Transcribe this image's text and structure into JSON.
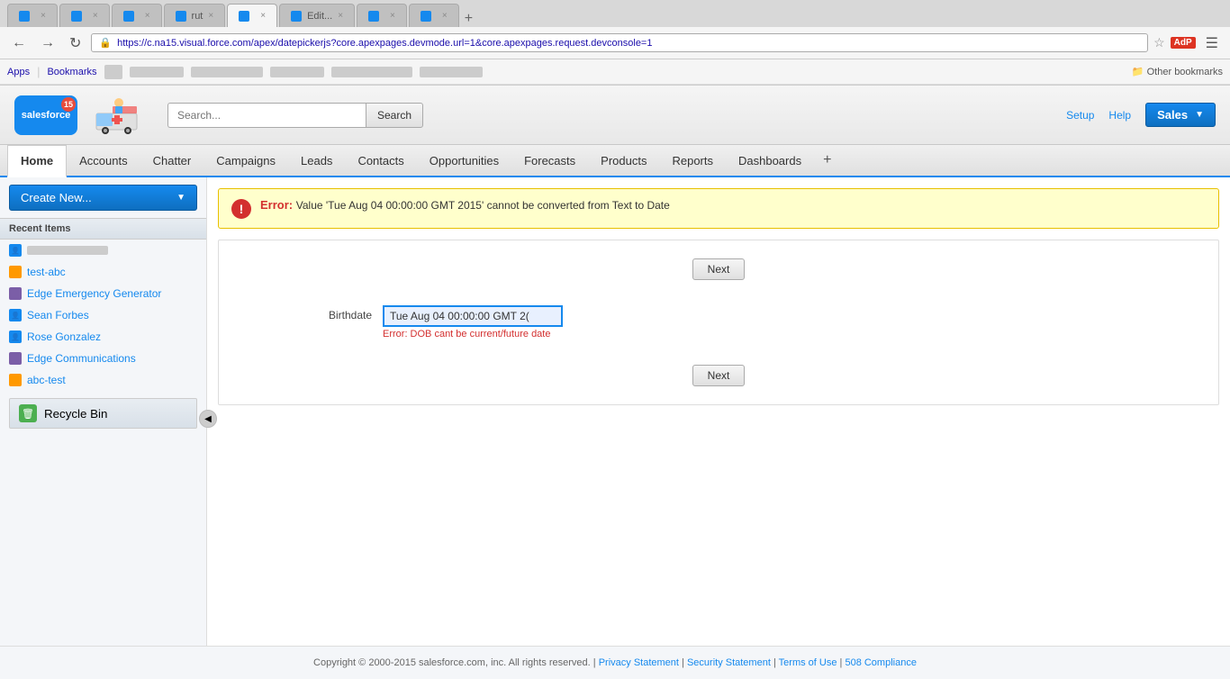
{
  "browser": {
    "url": "https://c.na15.visual.force.com/apex/datepickerjs?core.apexpages.devmode.url=1&core.apexpages.request.devconsole=1",
    "tabs": [
      {
        "label": "",
        "active": false
      },
      {
        "label": "",
        "active": false
      },
      {
        "label": "",
        "active": false
      },
      {
        "label": "rut",
        "active": false
      },
      {
        "label": "",
        "active": true
      },
      {
        "label": "Edit...",
        "active": false
      },
      {
        "label": "",
        "active": false
      },
      {
        "label": "",
        "active": false
      }
    ],
    "bookmarks": [
      "Apps",
      "Bookmarks"
    ],
    "other_bookmarks": "Other bookmarks"
  },
  "header": {
    "logo_text": "salesforce",
    "notification_count": "15",
    "search_placeholder": "Search...",
    "search_button": "Search",
    "setup_label": "Setup",
    "help_label": "Help",
    "sales_label": "Sales"
  },
  "navbar": {
    "items": [
      {
        "label": "Home",
        "active": true
      },
      {
        "label": "Accounts",
        "active": false
      },
      {
        "label": "Chatter",
        "active": false
      },
      {
        "label": "Campaigns",
        "active": false
      },
      {
        "label": "Leads",
        "active": false
      },
      {
        "label": "Contacts",
        "active": false
      },
      {
        "label": "Opportunities",
        "active": false
      },
      {
        "label": "Forecasts",
        "active": false
      },
      {
        "label": "Products",
        "active": false
      },
      {
        "label": "Reports",
        "active": false
      },
      {
        "label": "Dashboards",
        "active": false
      }
    ],
    "plus_label": "+"
  },
  "sidebar": {
    "create_new_label": "Create New...",
    "recent_items_title": "Recent Items",
    "recent_items": [
      {
        "type": "person",
        "label": "",
        "redacted": true
      },
      {
        "type": "lead",
        "label": "test-abc"
      },
      {
        "type": "account",
        "label": "Edge Emergency Generator"
      },
      {
        "type": "person",
        "label": "Sean Forbes"
      },
      {
        "type": "person",
        "label": "Rose Gonzalez"
      },
      {
        "type": "account",
        "label": "Edge Communications"
      },
      {
        "type": "lead",
        "label": "abc-test"
      }
    ],
    "recycle_bin_label": "Recycle Bin"
  },
  "error": {
    "label": "Error:",
    "message": "Value 'Tue Aug 04 00:00:00 GMT 2015' cannot be converted from Text to Date"
  },
  "form": {
    "next_button_top": "Next",
    "next_button_bottom": "Next",
    "birthdate_label": "Birthdate",
    "birthdate_value": "Tue Aug 04 00:00:00 GMT 2(",
    "field_error": "Error: DOB cant be current/future date"
  },
  "footer": {
    "copyright": "Copyright © 2000-2015 salesforce.com, inc. All rights reserved. |",
    "privacy": "Privacy Statement",
    "security": "Security Statement",
    "terms": "Terms of Use",
    "compliance": "508 Compliance"
  }
}
